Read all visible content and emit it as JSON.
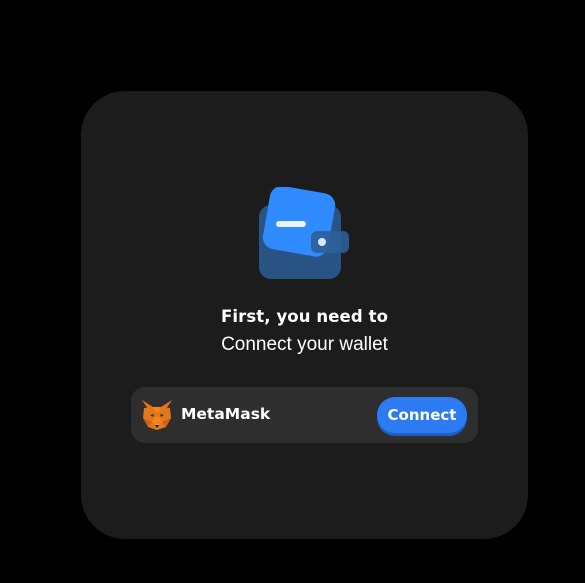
{
  "dialog": {
    "title": "First, you need to",
    "subtitle": "Connect your wallet",
    "hero_icon": "wallet-icon"
  },
  "wallet_option": {
    "name": "MetaMask",
    "icon": "metamask-fox-icon",
    "connect_label": "Connect"
  },
  "colors": {
    "background": "#000000",
    "card": "#1c1c1c",
    "row": "#2e2e2e",
    "accent": "#2c7bf2",
    "text": "#ffffff"
  }
}
